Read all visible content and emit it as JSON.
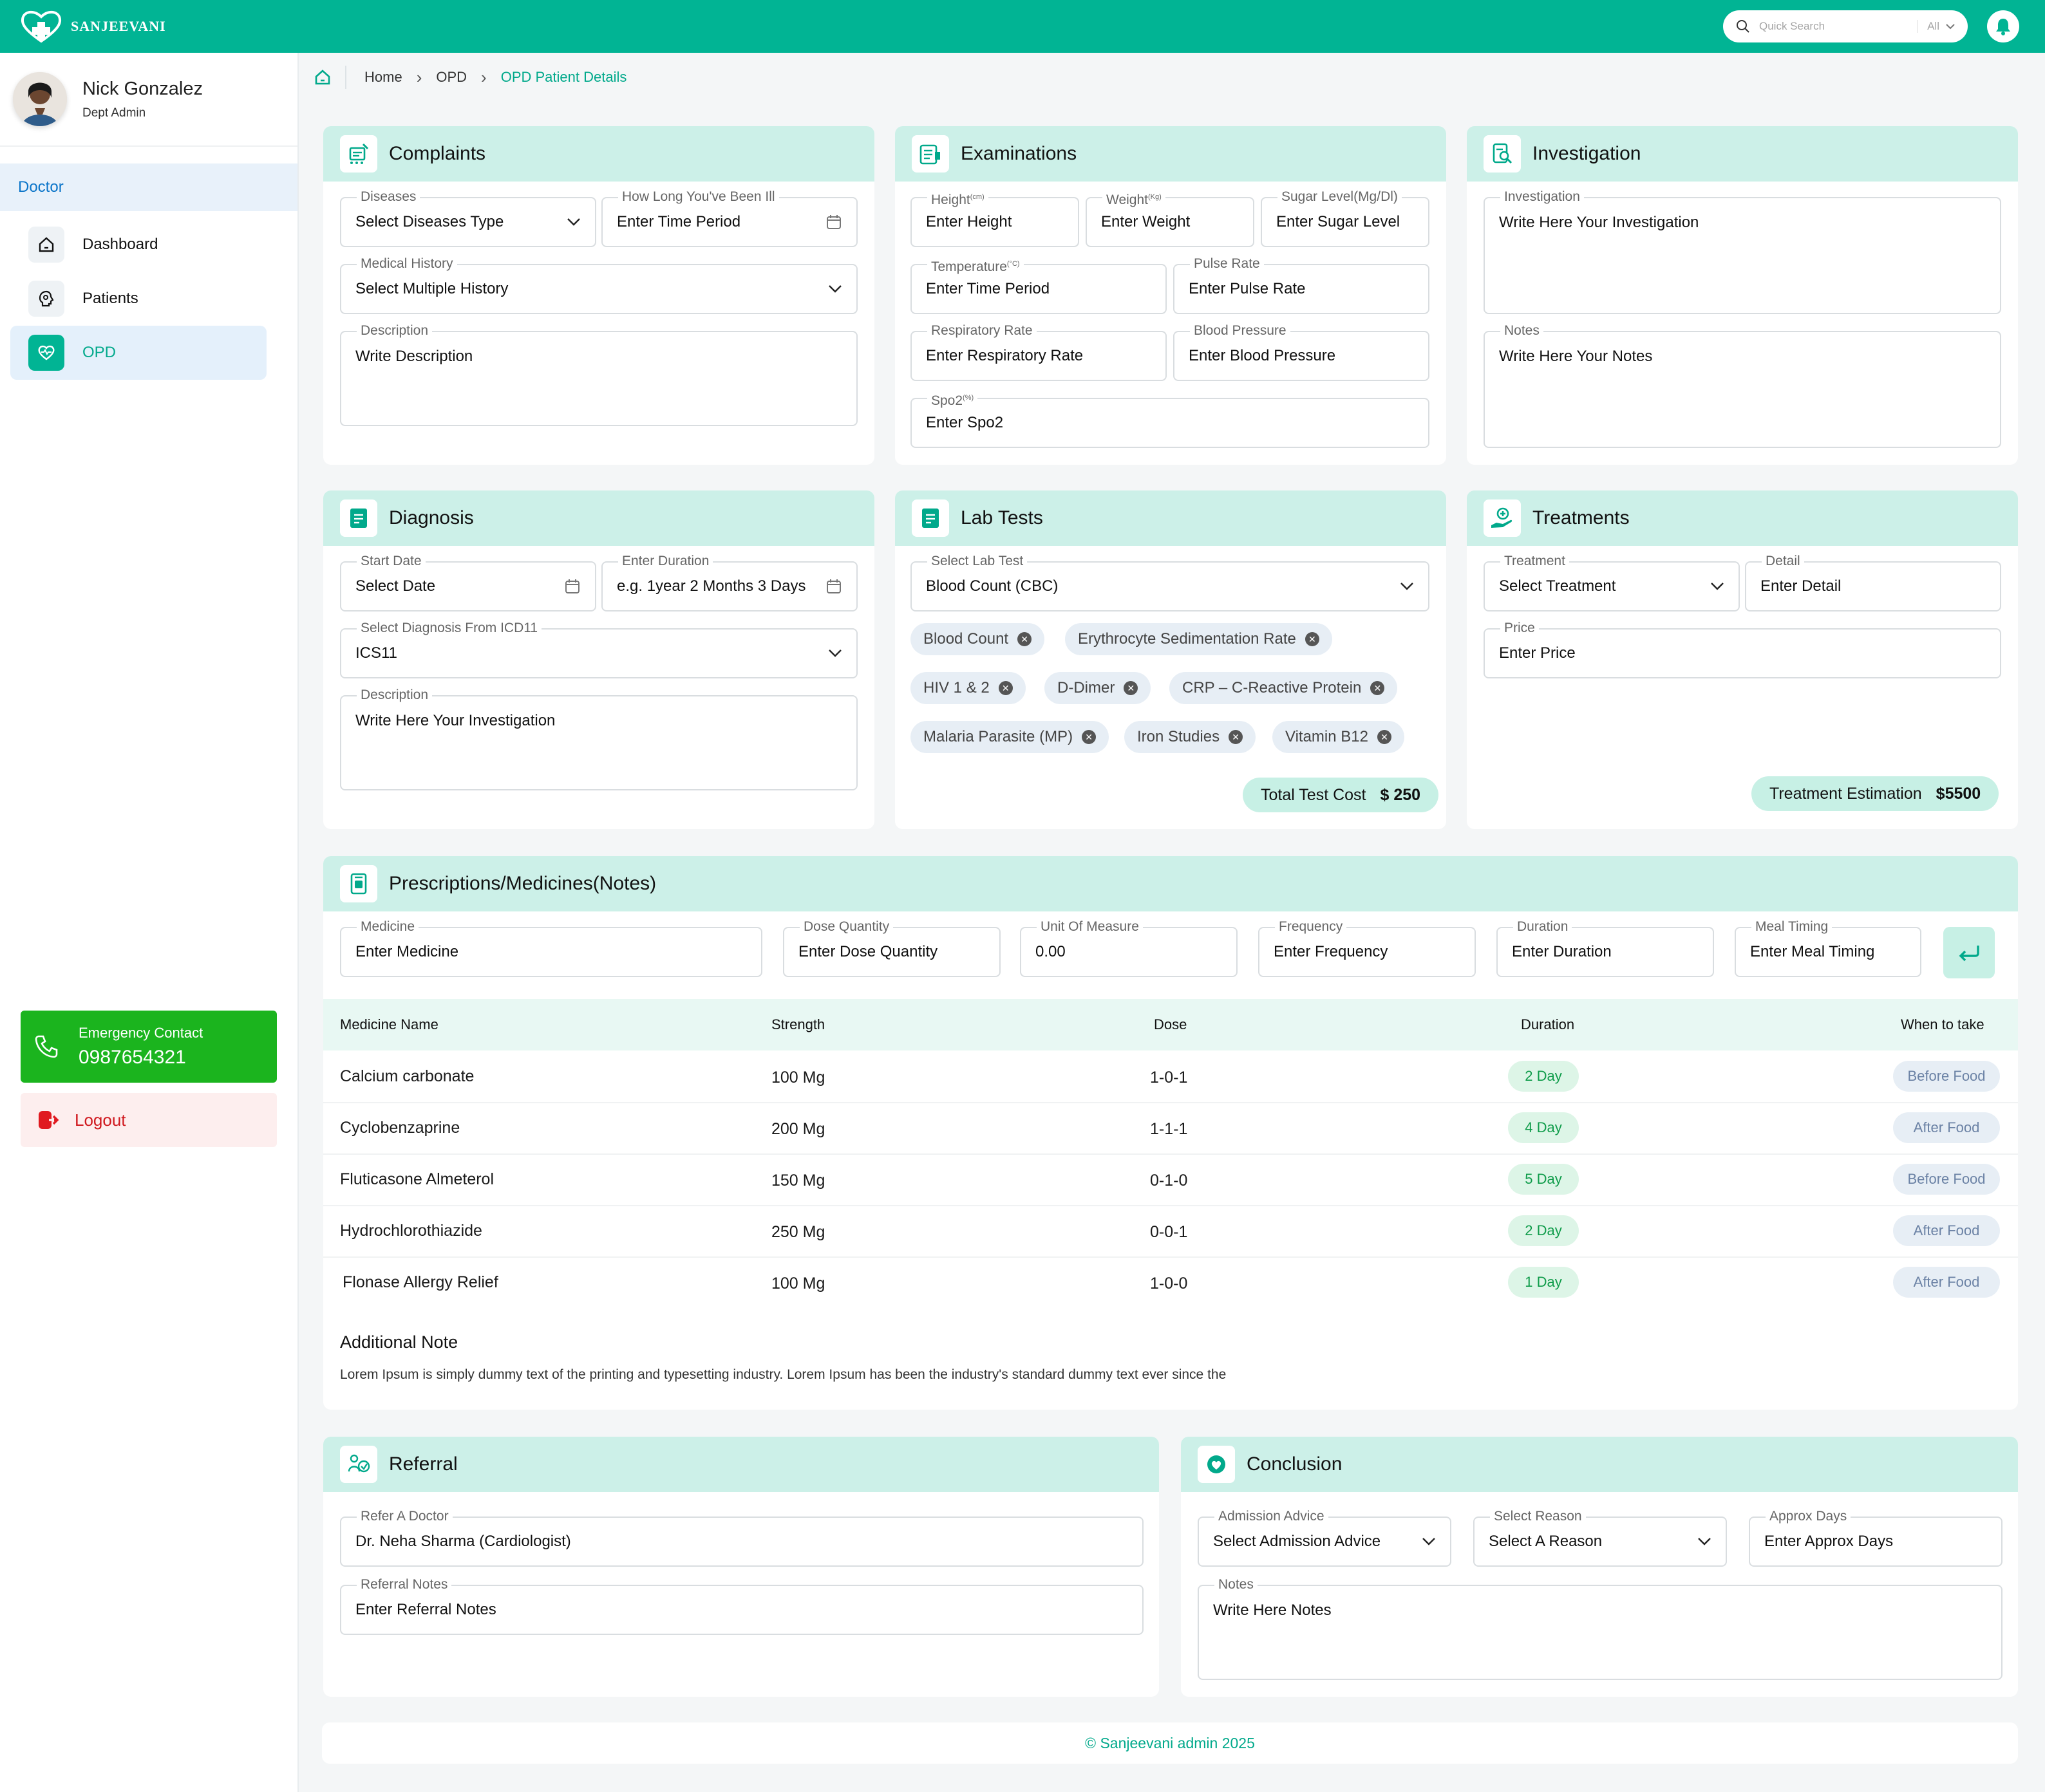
{
  "app": {
    "name": "SANJEEVANI"
  },
  "topbar": {
    "search_placeholder": "Quick Search",
    "search_scope": "All"
  },
  "user": {
    "name": "Nick Gonzalez",
    "role": "Dept Admin"
  },
  "sidebar": {
    "section": "Doctor",
    "items": [
      {
        "label": "Dashboard",
        "icon": "home-icon"
      },
      {
        "label": "Patients",
        "icon": "patient-icon"
      },
      {
        "label": "OPD",
        "icon": "heart-icon"
      }
    ],
    "emergency_label": "Emergency Contact",
    "emergency_number": "0987654321",
    "logout_label": "Logout"
  },
  "breadcrumb": {
    "home": "Home",
    "opd": "OPD",
    "current": "OPD Patient Details"
  },
  "complaints": {
    "title": "Complaints",
    "diseases_label": "Diseases",
    "diseases_value": "Select Diseases Type",
    "howlong_label": "How Long You've Been Ill",
    "howlong_value": "Enter Time Period",
    "history_label": "Medical History",
    "history_value": "Select Multiple History",
    "desc_label": "Description",
    "desc_value": "Write Description"
  },
  "examinations": {
    "title": "Examinations",
    "height_label": "Height",
    "height_unit": "(cm)",
    "height_value": "Enter Height",
    "weight_label": "Weight",
    "weight_unit": "(Kg)",
    "weight_value": "Enter Weight",
    "sugar_label": "Sugar Level(Mg/Dl)",
    "sugar_value": "Enter Sugar Level",
    "temp_label": "Temperature",
    "temp_unit": "(°C)",
    "temp_value": "Enter Time Period",
    "pulse_label": "Pulse Rate",
    "pulse_value": "Enter Pulse Rate",
    "resp_label": "Respiratory Rate",
    "resp_value": "Enter Respiratory Rate",
    "bp_label": "Blood Pressure",
    "bp_value": "Enter Blood Pressure",
    "spo2_label": "Spo2",
    "spo2_unit": "(%)",
    "spo2_value": "Enter Spo2"
  },
  "investigation": {
    "title": "Investigation",
    "inv_label": "Investigation",
    "inv_value": "Write Here Your Investigation",
    "notes_label": "Notes",
    "notes_value": "Write Here Your Notes"
  },
  "diagnosis": {
    "title": "Diagnosis",
    "start_label": "Start Date",
    "start_value": "Select Date",
    "duration_label": "Enter Duration",
    "duration_value": "e.g. 1year 2 Months 3 Days",
    "icd_label": "Select Diagnosis From ICD11",
    "icd_value": "ICS11",
    "desc_label": "Description",
    "desc_value": "Write Here Your Investigation"
  },
  "labtests": {
    "title": "Lab Tests",
    "select_label": "Select Lab Test",
    "select_value": "Blood Count (CBC)",
    "chips": [
      "Blood Count",
      "Erythrocyte Sedimentation Rate",
      "HIV 1 & 2",
      "D-Dimer",
      "CRP – C-Reactive Protein",
      "Malaria Parasite (MP)",
      "Iron Studies",
      "Vitamin B12"
    ],
    "total_label": "Total Test Cost",
    "total_value": "$ 250"
  },
  "treatments": {
    "title": "Treatments",
    "treat_label": "Treatment",
    "treat_value": "Select Treatment",
    "detail_label": "Detail",
    "detail_value": "Enter Detail",
    "price_label": "Price",
    "price_value": "Enter Price",
    "estimation_label": "Treatment Estimation",
    "estimation_value": "$5500"
  },
  "prescriptions": {
    "title": "Prescriptions/Medicines(Notes)",
    "medicine_label": "Medicine",
    "medicine_value": "Enter Medicine",
    "dose_label": "Dose Quantity",
    "dose_value": "Enter Dose Quantity",
    "unit_label": "Unit Of Measure",
    "unit_value": "0.00",
    "freq_label": "Frequency",
    "freq_value": "Enter Frequency",
    "duration_label": "Duration",
    "duration_value": "Enter Duration",
    "meal_label": "Meal Timing",
    "meal_value": "Enter Meal Timing",
    "columns": [
      "Medicine Name",
      "Strength",
      "Dose",
      "Duration",
      "When to take"
    ],
    "rows": [
      {
        "name": "Calcium carbonate",
        "strength": "100 Mg",
        "dose": "1-0-1",
        "duration": "2 Day",
        "when": "Before Food"
      },
      {
        "name": "Cyclobenzaprine",
        "strength": "200 Mg",
        "dose": "1-1-1",
        "duration": "4 Day",
        "when": "After Food"
      },
      {
        "name": "Fluticasone Almeterol",
        "strength": "150 Mg",
        "dose": "0-1-0",
        "duration": "5 Day",
        "when": "Before Food"
      },
      {
        "name": "Hydrochlorothiazide",
        "strength": "250 Mg",
        "dose": "0-0-1",
        "duration": "2 Day",
        "when": "After Food"
      },
      {
        "name": "Flonase Allergy Relief",
        "strength": "100 Mg",
        "dose": "1-0-0",
        "duration": "1 Day",
        "when": "After Food"
      }
    ],
    "note_title": "Additional Note",
    "note_text": "Lorem Ipsum is simply dummy text of the printing and typesetting industry. Lorem Ipsum has been the industry's standard dummy text ever since the"
  },
  "referral": {
    "title": "Referral",
    "doctor_label": "Refer A Doctor",
    "doctor_value": "Dr. Neha Sharma (Cardiologist)",
    "notes_label": "Referral Notes",
    "notes_value": "Enter Referral Notes"
  },
  "conclusion": {
    "title": "Conclusion",
    "admission_label": "Admission Advice",
    "admission_value": "Select Admission Advice",
    "reason_label": "Select Reason",
    "reason_value": "Select A Reason",
    "days_label": "Approx Days",
    "days_value": "Enter Approx Days",
    "notes_label": "Notes",
    "notes_value": "Write Here Notes"
  },
  "footer": {
    "text": "© Sanjeevani admin 2025"
  }
}
